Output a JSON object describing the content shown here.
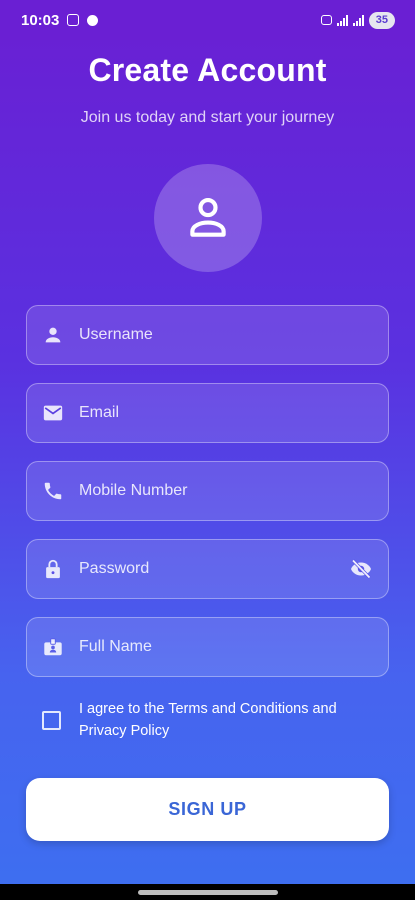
{
  "status_bar": {
    "time": "10:03",
    "battery": "35"
  },
  "header": {
    "title": "Create Account",
    "subtitle": "Join us today and start your journey"
  },
  "form": {
    "username_placeholder": "Username",
    "email_placeholder": "Email",
    "mobile_placeholder": "Mobile Number",
    "password_placeholder": "Password",
    "fullname_placeholder": "Full Name"
  },
  "agreement": {
    "text": "I agree to the Terms and Conditions and Privacy Policy",
    "checked": false
  },
  "actions": {
    "signup_label": "SIGN UP"
  },
  "icons": {
    "avatar": "person-icon",
    "username": "person-icon",
    "email": "mail-icon",
    "mobile": "phone-icon",
    "password": "lock-icon",
    "password_toggle": "eye-off-icon",
    "fullname": "badge-icon"
  },
  "colors": {
    "gradient_top": "#6a1fd3",
    "gradient_bottom": "#3d6ff0",
    "button_text": "#3a66d6"
  }
}
